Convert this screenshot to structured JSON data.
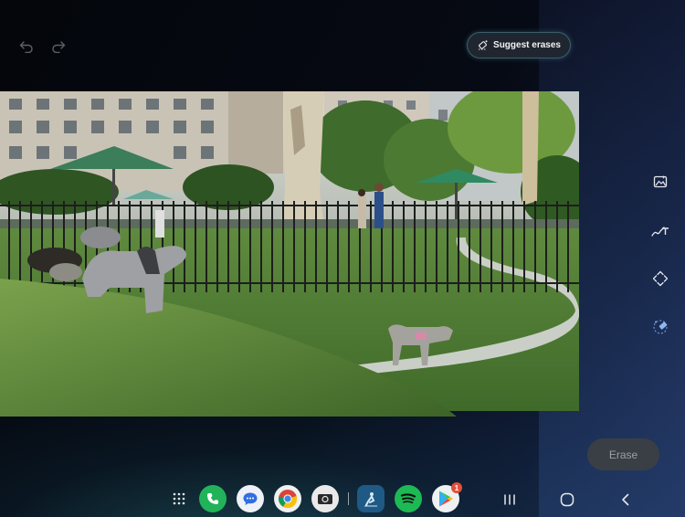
{
  "toolbar": {
    "undo_icon": "undo-icon",
    "redo_icon": "redo-icon",
    "suggest_label": "Suggest erases"
  },
  "photo": {
    "description_icon": "photo-being-edited"
  },
  "side_tools": [
    "image-adjust-icon",
    "handwriting-icon",
    "resize-icon",
    "eraser-icon"
  ],
  "erase_button": {
    "label": "Erase"
  },
  "dock": {
    "apps": [
      "all-apps",
      "phone",
      "messages",
      "chrome",
      "camera",
      "kindle",
      "spotify",
      "play-store"
    ],
    "play_store_badge": "1"
  },
  "nav": [
    "recents",
    "home",
    "back"
  ],
  "colors": {
    "accent_border": "#3b5d6a",
    "erase_bg": "#3a3f45"
  }
}
